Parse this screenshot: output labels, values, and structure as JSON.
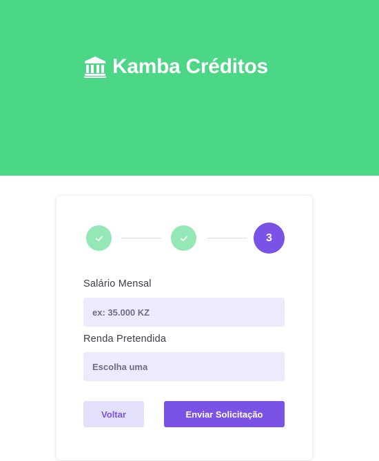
{
  "header": {
    "title": "Kamba Créditos",
    "icon": "bank-icon",
    "background_color": "#4bd785"
  },
  "stepper": {
    "steps": [
      {
        "state": "done",
        "icon": "check-icon"
      },
      {
        "state": "done",
        "icon": "check-icon"
      },
      {
        "state": "current",
        "label": "3"
      }
    ],
    "done_color": "#93e8b5",
    "current_color": "#7a52e6"
  },
  "form": {
    "salary": {
      "label": "Salário Mensal",
      "placeholder": "ex: 35.000 KZ",
      "value": ""
    },
    "income": {
      "label": "Renda Pretendida",
      "placeholder": "Escolha uma",
      "value": ""
    }
  },
  "actions": {
    "back_label": "Voltar",
    "submit_label": "Enviar Solicitação",
    "accent_color": "#7a52e6"
  }
}
